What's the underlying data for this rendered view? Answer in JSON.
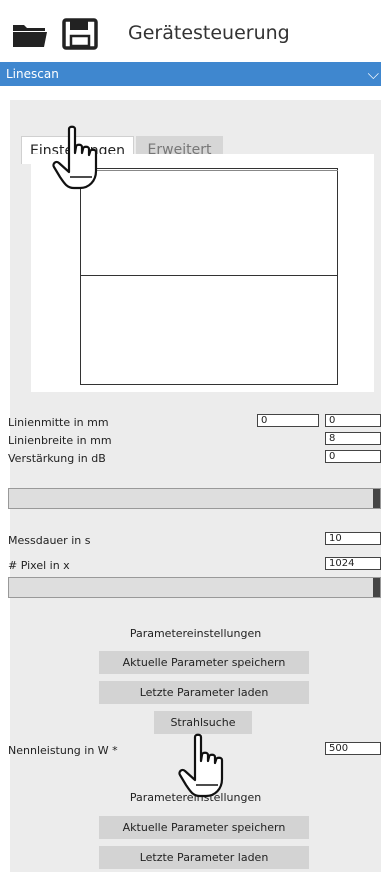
{
  "header": {
    "title": "Gerätesteuerung",
    "icons": [
      "folder-icon",
      "save-icon"
    ]
  },
  "mode_select": {
    "value": "Linescan"
  },
  "tabs": [
    {
      "label": "Einstellungen",
      "active": true
    },
    {
      "label": "Erweitert",
      "active": false
    }
  ],
  "fields": {
    "linienmitte": {
      "label": "Linienmitte in mm",
      "value1": "0",
      "value2": "0"
    },
    "linienbreite": {
      "label": "Linienbreite in mm",
      "value": "8"
    },
    "verstaerkung": {
      "label": "Verstärkung in dB",
      "value": "0"
    },
    "messdauer": {
      "label": "Messdauer in s",
      "value": "10"
    },
    "pixel": {
      "label": "# Pixel in x",
      "value": "1024"
    },
    "nennleistung": {
      "label": "Nennleistung in W *",
      "value": "500"
    }
  },
  "parameters": {
    "title": "Parametereinstellungen",
    "save_label": "Aktuelle Parameter speichern",
    "load_label": "Letzte Parameter laden",
    "search_label": "Strahlsuche"
  },
  "parameters2": {
    "title": "Parametereinstellungen",
    "save_label": "Aktuelle Parameter speichern",
    "load_label": "Letzte Parameter laden"
  },
  "colors": {
    "accent": "#3f87cf",
    "panel": "#ececec",
    "button": "#d3d3d3"
  }
}
